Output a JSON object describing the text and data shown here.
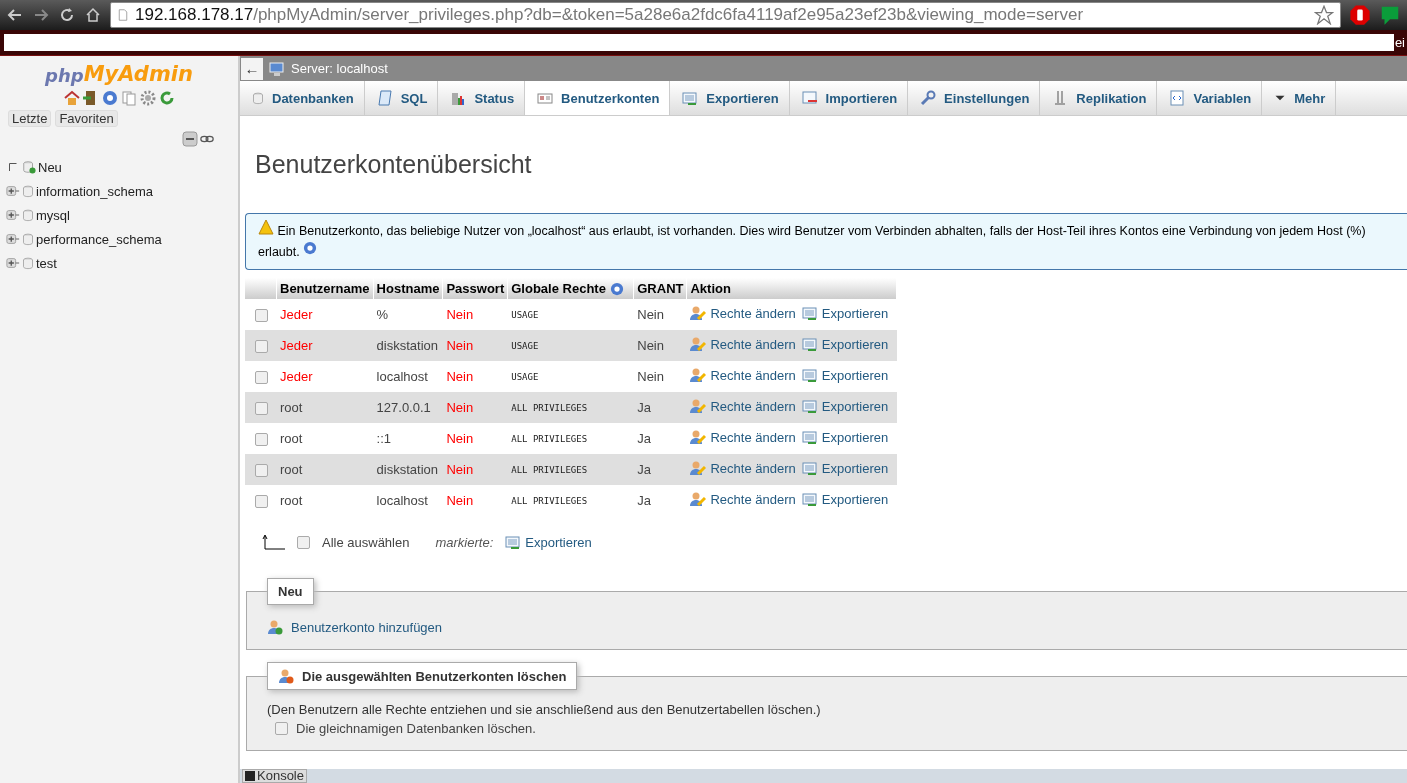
{
  "browser": {
    "url_host": "192.168.178.17",
    "url_path": "/phpMyAdmin/server_privileges.php?db=&token=5a28e6a2fdc6fa4119af2e95a23ef23b&viewing_mode=server",
    "strip_text": "ei"
  },
  "back_button": "←",
  "sidebar": {
    "logo_php": "php",
    "logo_name": "MyAdmin",
    "buttons": [
      "Letzte",
      "Favoriten"
    ],
    "tree": [
      {
        "label": "Neu",
        "kind": "new"
      },
      {
        "label": "information_schema",
        "kind": "db"
      },
      {
        "label": "mysql",
        "kind": "db"
      },
      {
        "label": "performance_schema",
        "kind": "db"
      },
      {
        "label": "test",
        "kind": "db"
      }
    ]
  },
  "breadcrumb": "Server: localhost",
  "tabs": [
    {
      "label": "Datenbanken",
      "selected": false
    },
    {
      "label": "SQL",
      "selected": false
    },
    {
      "label": "Status",
      "selected": false
    },
    {
      "label": "Benutzerkonten",
      "selected": true
    },
    {
      "label": "Exportieren",
      "selected": false
    },
    {
      "label": "Importieren",
      "selected": false
    },
    {
      "label": "Einstellungen",
      "selected": false
    },
    {
      "label": "Replikation",
      "selected": false
    },
    {
      "label": "Variablen",
      "selected": false
    },
    {
      "label": "Mehr",
      "selected": false
    }
  ],
  "title": "Benutzerkontenübersicht",
  "notice": "Ein Benutzerkonto, das beliebige Nutzer von „localhost“ aus erlaubt, ist vorhanden. Dies wird Benutzer vom Verbinden abhalten, falls der Host-Teil ihres Kontos eine Verbindung von jedem Host (%) erlaubt.",
  "table": {
    "columns": [
      "Benutzername",
      "Hostname",
      "Passwort",
      "Globale Rechte",
      "GRANT",
      "Aktion"
    ],
    "rows": [
      {
        "checked": false,
        "user": "Jeder",
        "user_warning": true,
        "host": "%",
        "password": "Nein",
        "password_warning": true,
        "rights": "USAGE",
        "grant": "Nein",
        "edit": "Rechte ändern",
        "export": "Exportieren"
      },
      {
        "checked": false,
        "user": "Jeder",
        "user_warning": true,
        "host": "diskstation",
        "password": "Nein",
        "password_warning": true,
        "rights": "USAGE",
        "grant": "Nein",
        "edit": "Rechte ändern",
        "export": "Exportieren"
      },
      {
        "checked": false,
        "user": "Jeder",
        "user_warning": true,
        "host": "localhost",
        "password": "Nein",
        "password_warning": true,
        "rights": "USAGE",
        "grant": "Nein",
        "edit": "Rechte ändern",
        "export": "Exportieren"
      },
      {
        "checked": false,
        "user": "root",
        "user_warning": false,
        "host": "127.0.0.1",
        "password": "Nein",
        "password_warning": true,
        "rights": "ALL PRIVILEGES",
        "grant": "Ja",
        "edit": "Rechte ändern",
        "export": "Exportieren"
      },
      {
        "checked": false,
        "user": "root",
        "user_warning": false,
        "host": "::1",
        "password": "Nein",
        "password_warning": true,
        "rights": "ALL PRIVILEGES",
        "grant": "Ja",
        "edit": "Rechte ändern",
        "export": "Exportieren"
      },
      {
        "checked": false,
        "user": "root",
        "user_warning": false,
        "host": "diskstation",
        "password": "Nein",
        "password_warning": true,
        "rights": "ALL PRIVILEGES",
        "grant": "Ja",
        "edit": "Rechte ändern",
        "export": "Exportieren"
      },
      {
        "checked": false,
        "user": "root",
        "user_warning": false,
        "host": "localhost",
        "password": "Nein",
        "password_warning": true,
        "rights": "ALL PRIVILEGES",
        "grant": "Ja",
        "edit": "Rechte ändern",
        "export": "Exportieren"
      }
    ]
  },
  "bulk": {
    "select_all": {
      "label": "Alle auswählen",
      "checked": false
    },
    "marked": "markierte:",
    "export": "Exportieren"
  },
  "new_section": {
    "legend": "Neu",
    "link": "Benutzerkonto hinzufügen"
  },
  "delete_section": {
    "legend": "Die ausgewählten Benutzerkonten löschen",
    "description": "(Den Benutzern alle Rechte entziehen und sie anschließend aus den Benutzertabellen löschen.)",
    "option": {
      "label": "Die gleichnamigen Datenbanken löschen.",
      "checked": false
    }
  },
  "console": "Konsole"
}
